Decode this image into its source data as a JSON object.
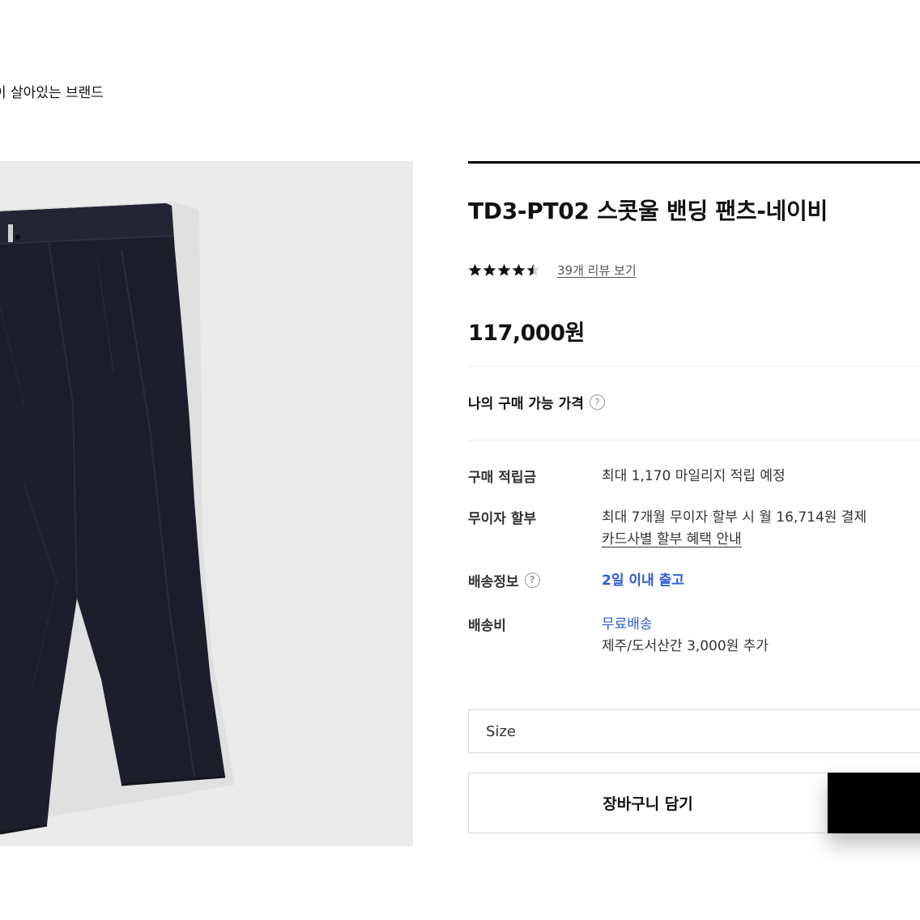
{
  "header": {
    "tagline": "이 살아있는 브랜드"
  },
  "product": {
    "title": "TD3-PT02 스콧울 밴딩 팬츠-네이비",
    "rating": {
      "score": 4.5,
      "max": 5
    },
    "review_link": "39개 리뷰 보기",
    "price": "117,000원",
    "my_price_label": "나의 구매 가능 가격",
    "help_glyph": "?"
  },
  "details": {
    "points": {
      "label": "구매 적립금",
      "value": "최대 1,170 마일리지 적립 예정"
    },
    "installment": {
      "label": "무이자 할부",
      "value": "최대 7개월 무이자 할부 시 월 16,714원 결제",
      "link": "카드사별 할부 혜택 안내"
    },
    "shipping_info": {
      "label": "배송정보",
      "value": "2일 이내 출고"
    },
    "shipping_fee": {
      "label": "배송비",
      "value": "무료배송",
      "note": "제주/도서산간 3,000원 추가"
    }
  },
  "options": {
    "size_placeholder": "Size"
  },
  "actions": {
    "cart_label": "장바구니 담기",
    "buy_label": ""
  },
  "colors": {
    "accent_blue": "#2e5bdb",
    "image_bg": "#ebebeb",
    "pants": "#1c1e2c"
  }
}
